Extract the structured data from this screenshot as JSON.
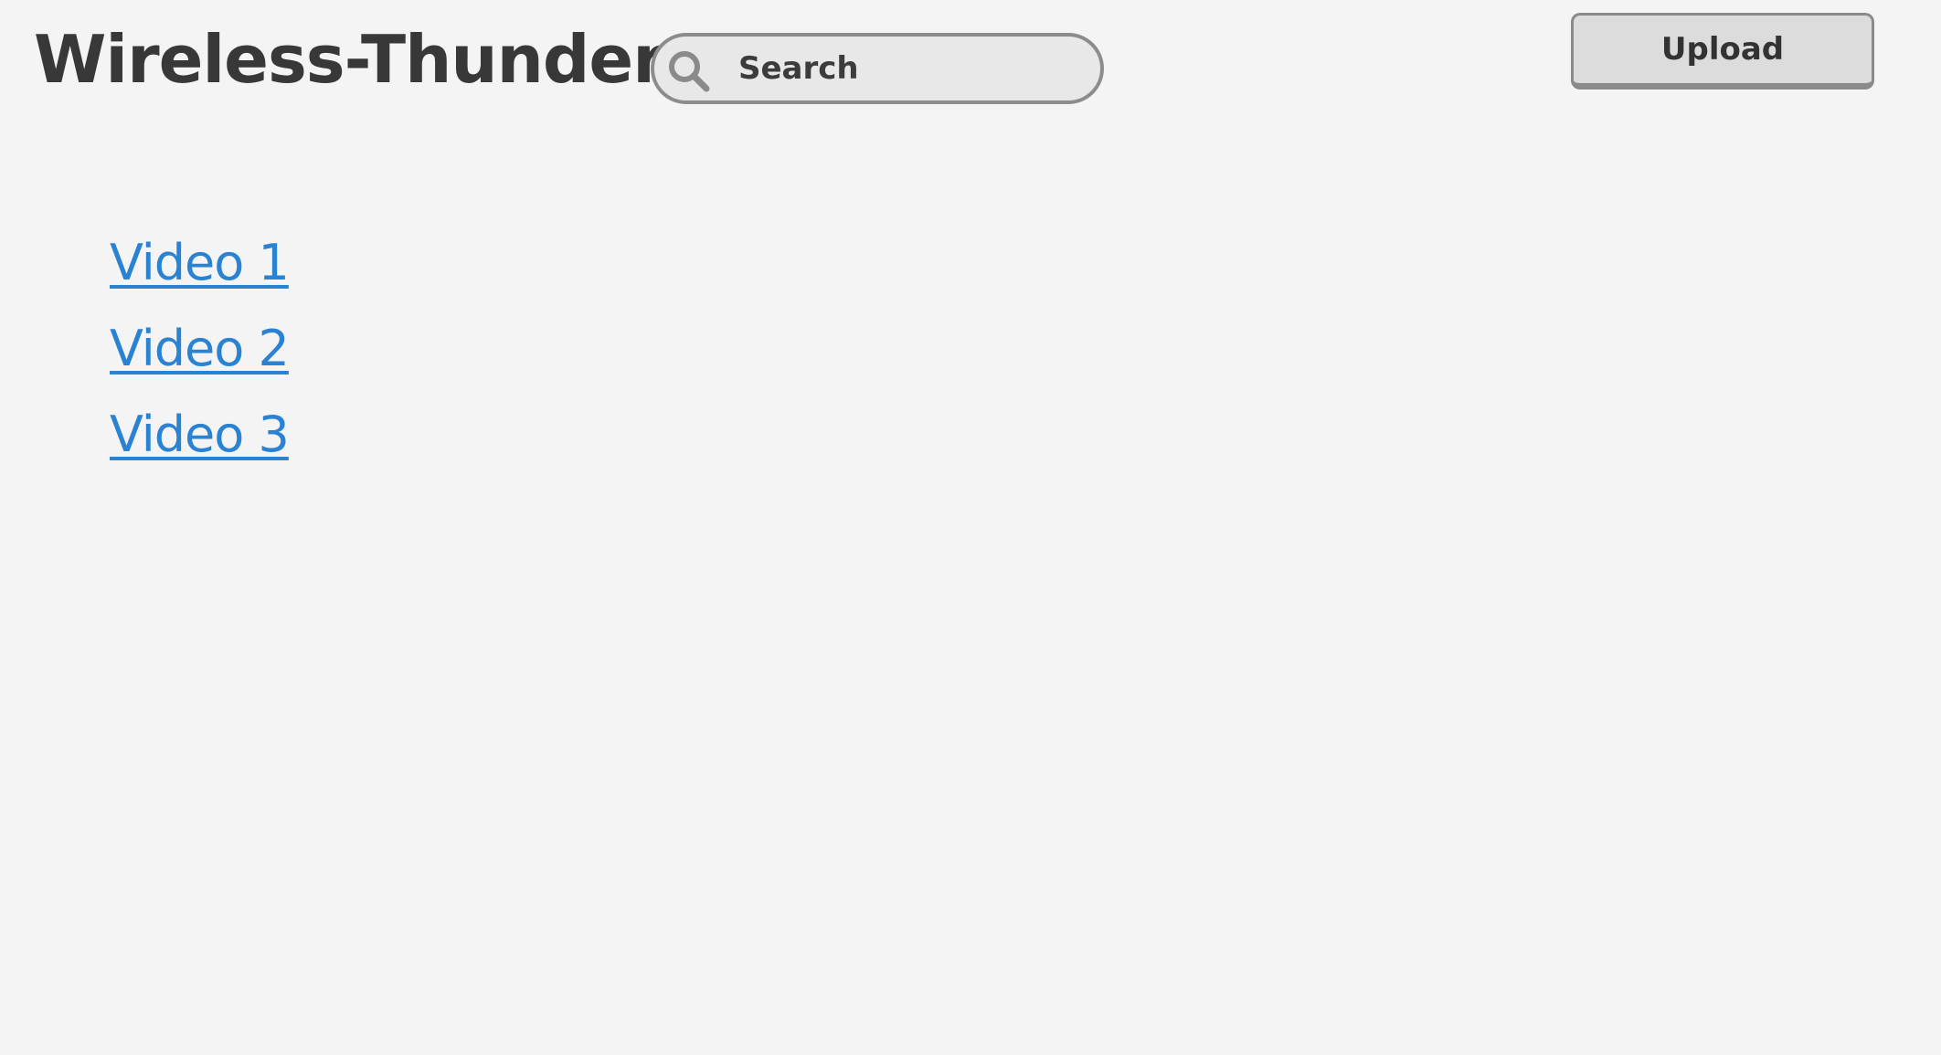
{
  "header": {
    "title": "Wireless-Thunder",
    "search": {
      "placeholder": "Search",
      "value": "",
      "icon": "search-icon"
    },
    "upload_label": "Upload"
  },
  "videos": [
    {
      "label": "Video 1"
    },
    {
      "label": "Video 2"
    },
    {
      "label": "Video 3"
    }
  ],
  "colors": {
    "background": "#f4f4f4",
    "title": "#383838",
    "link": "#2a82d2",
    "control_fill": "#e8e8e8",
    "control_border": "#8c8c8c"
  }
}
